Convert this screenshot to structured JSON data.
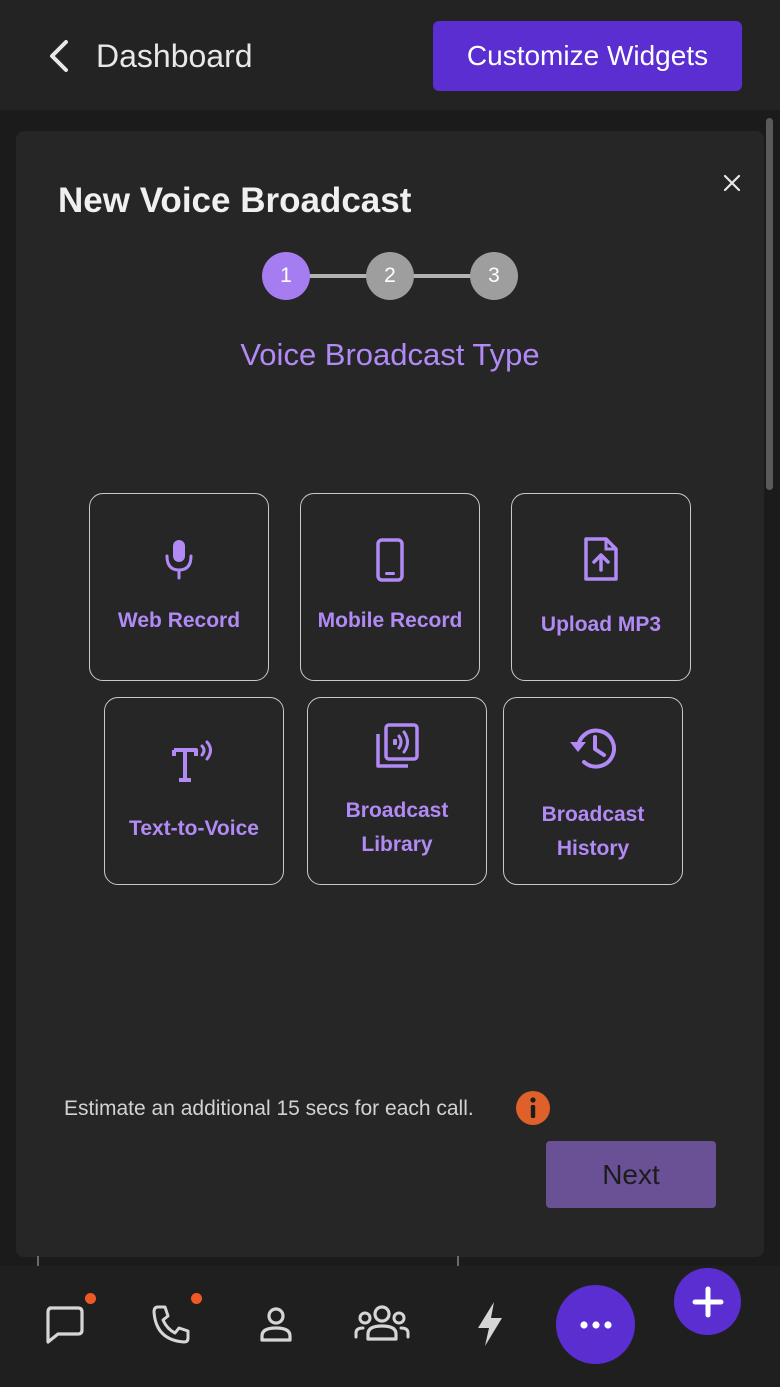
{
  "header": {
    "back_icon": "chevron-left-icon",
    "title": "Dashboard",
    "customize_label": "Customize Widgets"
  },
  "modal": {
    "title": "New Voice Broadcast",
    "close_icon": "close-icon",
    "steps": [
      {
        "label": "1",
        "state": "active"
      },
      {
        "label": "2",
        "state": "inactive"
      },
      {
        "label": "3",
        "state": "inactive"
      }
    ],
    "section_title": "Voice Broadcast Type",
    "options": [
      {
        "label": "Web Record",
        "icon": "microphone-icon"
      },
      {
        "label": "Mobile Record",
        "icon": "mobile-phone-icon"
      },
      {
        "label": "Upload MP3",
        "icon": "file-upload-icon"
      },
      {
        "label": "Text-to-Voice",
        "icon": "text-to-speech-icon"
      },
      {
        "label": "Broadcast Library",
        "label_line1": "Broadcast",
        "label_line2": "Library",
        "icon": "audio-library-icon"
      },
      {
        "label": "Broadcast History",
        "label_line1": "Broadcast",
        "label_line2": "History",
        "icon": "history-icon"
      }
    ],
    "estimate_note": "Estimate an additional 15 secs for each call.",
    "info_icon": "info-icon",
    "next_label": "Next"
  },
  "nav": {
    "items": [
      {
        "icon": "chat-bubble-icon",
        "badge": true
      },
      {
        "icon": "phone-icon",
        "badge": true
      },
      {
        "icon": "person-icon",
        "badge": false
      },
      {
        "icon": "group-icon",
        "badge": false
      },
      {
        "icon": "lightning-bolt-icon",
        "badge": false
      },
      {
        "icon": "more-dots-icon",
        "badge": false
      }
    ],
    "fab_icon": "plus-icon"
  },
  "colors": {
    "accent": "#5b2ed2",
    "accent_light": "#b18af5",
    "step_active": "#a57df0",
    "badge": "#ee5a24",
    "next_button": "#6a5196"
  }
}
